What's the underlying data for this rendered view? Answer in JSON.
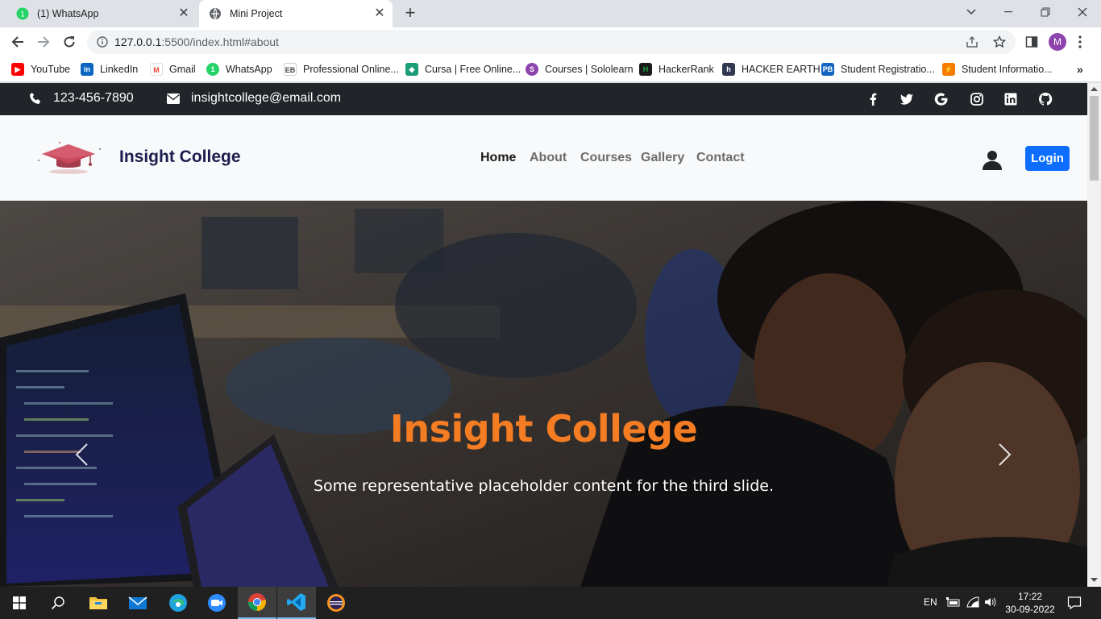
{
  "browser": {
    "tabs": [
      {
        "title": "(1) WhatsApp",
        "icon": "whatsapp-icon",
        "active": false
      },
      {
        "title": "Mini Project",
        "icon": "globe-icon",
        "active": true
      }
    ],
    "url_host": "127.0.0.1",
    "url_rest": ":5500/index.html#about",
    "profile_initial": "M",
    "bookmarks": [
      {
        "label": "YouTube",
        "icon": "youtube-icon",
        "color": "#ff0000"
      },
      {
        "label": "LinkedIn",
        "icon": "linkedin-icon",
        "color": "#0a66c2"
      },
      {
        "label": "Gmail",
        "icon": "gmail-icon",
        "color": "#ea4335"
      },
      {
        "label": "WhatsApp",
        "icon": "whatsapp-icon",
        "color": "#25d366"
      },
      {
        "label": "Professional Online...",
        "icon": "eb-icon",
        "color": "#444444"
      },
      {
        "label": "Cursa | Free Online...",
        "icon": "cursa-icon",
        "color": "#1b9e77"
      },
      {
        "label": "Courses | Sololearn",
        "icon": "sololearn-icon",
        "color": "#8e44ad"
      },
      {
        "label": "HackerRank",
        "icon": "hackerrank-icon",
        "color": "#1ba94c"
      },
      {
        "label": "HACKER EARTH",
        "icon": "hackerearth-icon",
        "color": "#323754"
      },
      {
        "label": "Student Registratio...",
        "icon": "pb-icon",
        "color": "#1565c0"
      },
      {
        "label": "Student Informatio...",
        "icon": "info-icon",
        "color": "#f57c00"
      }
    ]
  },
  "site": {
    "phone": "123-456-7890",
    "email": "insightcollege@email.com",
    "brand": "Insight College",
    "nav": [
      "Home",
      "About",
      "Courses",
      "Gallery",
      "Contact"
    ],
    "login_label": "Login",
    "hero_title": "Insight College",
    "hero_text": "Some representative placeholder content for the third slide.",
    "accent_color": "#f47c23",
    "primary_color": "#0d6efd"
  },
  "taskbar": {
    "language": "EN",
    "time": "17:22",
    "date": "30-09-2022"
  }
}
